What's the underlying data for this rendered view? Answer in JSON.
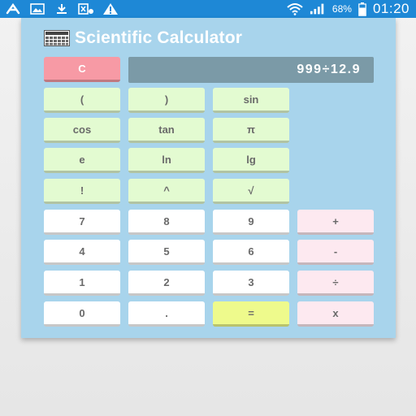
{
  "status_bar": {
    "icons": [
      "avast-icon",
      "gallery-icon",
      "download-icon",
      "sim-settings-icon",
      "warning-icon"
    ],
    "right_icons": [
      "wifi-icon",
      "signal-icon",
      "battery-icon"
    ],
    "battery_percent": "68%",
    "time": "01:20"
  },
  "app": {
    "title": "Scientific Calculator",
    "title_icon": "calculator-icon",
    "display": "999÷12.9",
    "clear_label": "C",
    "keys": {
      "open_paren": "(",
      "close_paren": ")",
      "sin": "sin",
      "cos": "cos",
      "tan": "tan",
      "pi": "π",
      "e": "e",
      "ln": "ln",
      "lg": "lg",
      "factorial": "!",
      "power": "^",
      "sqrt": "√",
      "seven": "7",
      "eight": "8",
      "nine": "9",
      "four": "4",
      "five": "5",
      "six": "6",
      "one": "1",
      "two": "2",
      "three": "3",
      "zero": "0",
      "dot": ".",
      "equals": "=",
      "plus": "+",
      "minus": "-",
      "divide": "÷",
      "multiply": "x"
    },
    "colors": {
      "background": "#a8d4ec",
      "function_key": "#e3fbd1",
      "number_key": "#ffffff",
      "operator_key": "#fde9f0",
      "equals_key": "#eefa8c",
      "clear_key": "#f79aa5",
      "display": "#7b9aa7",
      "status_bar": "#1e88d6"
    }
  }
}
